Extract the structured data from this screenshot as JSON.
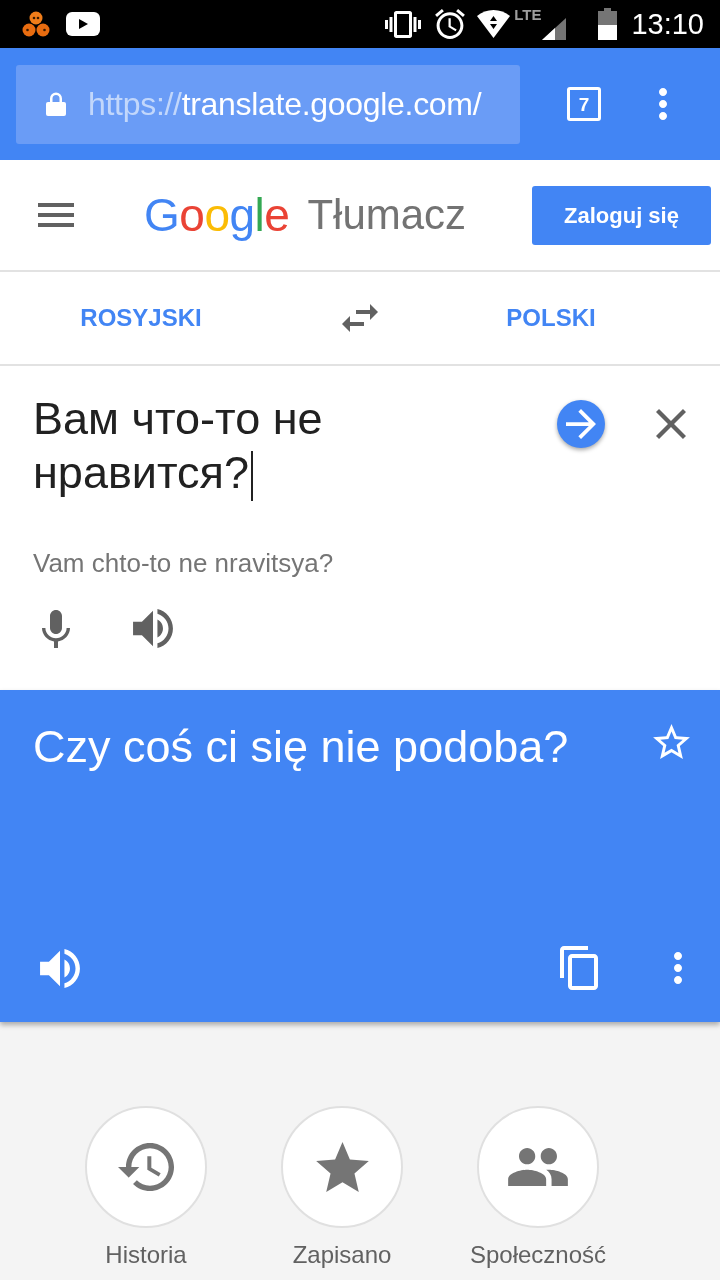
{
  "status_bar": {
    "network": "LTE",
    "time": "13:10"
  },
  "browser": {
    "url_scheme": "https://",
    "url_rest": "translate.google.com/",
    "tab_count": "7"
  },
  "header": {
    "logo": [
      {
        "text": "G",
        "color": "#4285f4"
      },
      {
        "text": "o",
        "color": "#ea4335"
      },
      {
        "text": "o",
        "color": "#fbbc05"
      },
      {
        "text": "g",
        "color": "#4285f4"
      },
      {
        "text": "l",
        "color": "#34a853"
      },
      {
        "text": "e",
        "color": "#ea4335"
      }
    ],
    "product": "Tłumacz",
    "sign_in": "Zaloguj się"
  },
  "languages": {
    "source": "ROSYJSKI",
    "target": "POLSKI"
  },
  "input": {
    "value": "Вам что-то не нравится?",
    "transliteration": "Vam chto-to ne nravitsya?"
  },
  "output": {
    "text": "Czy coś ci się nie podoba?",
    "starred": false
  },
  "shortcuts": [
    {
      "kind": "history",
      "label": "Historia"
    },
    {
      "kind": "saved",
      "label": "Zapisano"
    },
    {
      "kind": "community",
      "label": "Społeczność"
    }
  ]
}
